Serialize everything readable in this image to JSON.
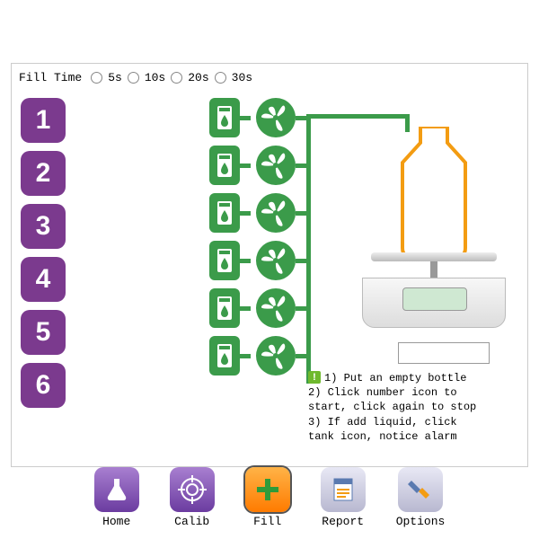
{
  "fill_time": {
    "label": "Fill Time",
    "options": [
      "5s",
      "10s",
      "20s",
      "30s"
    ]
  },
  "numbers": [
    "1",
    "2",
    "3",
    "4",
    "5",
    "6"
  ],
  "weight_display": "",
  "instructions": {
    "l1": "1) Put an empty bottle",
    "l2": "2) Click number icon to",
    "l3": "start, click again to stop",
    "l4": "3) If add liquid, click",
    "l5": "tank icon, notice alarm"
  },
  "toolbar": {
    "home": "Home",
    "calib": "Calib",
    "fill": "Fill",
    "report": "Report",
    "options": "Options"
  }
}
